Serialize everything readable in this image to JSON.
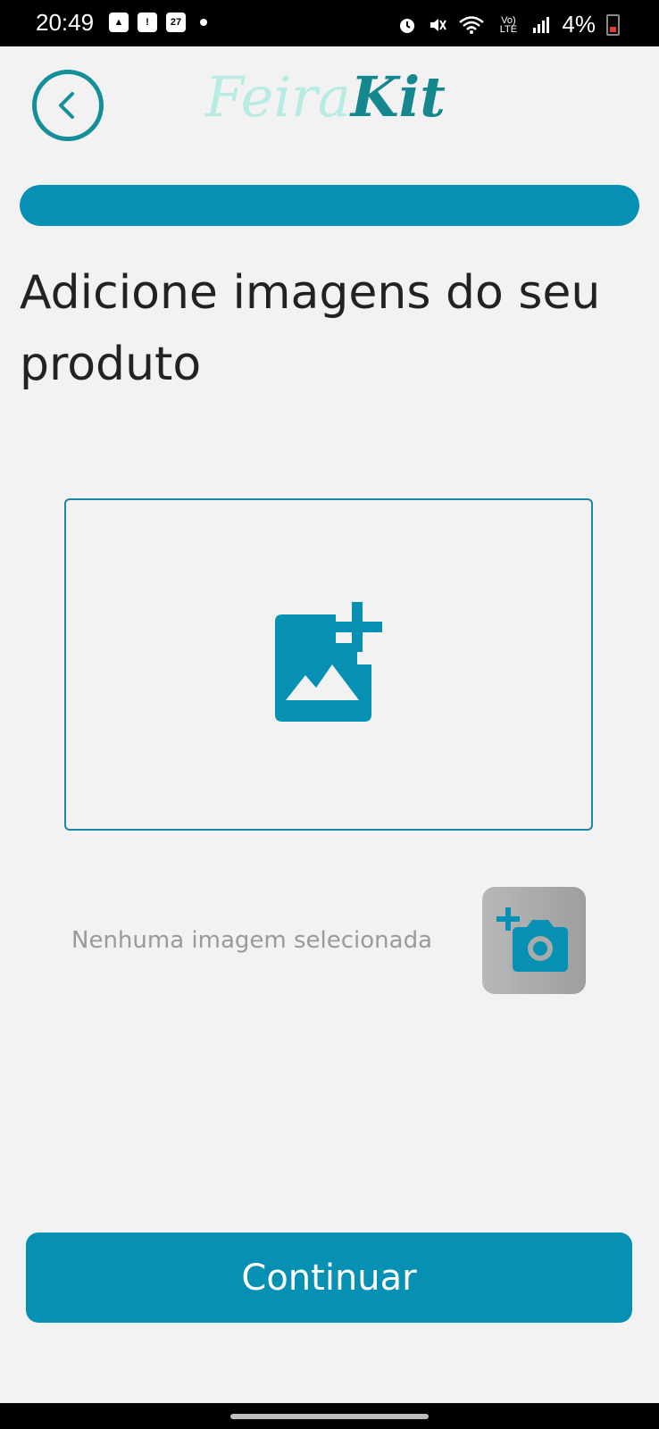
{
  "status_bar": {
    "time": "20:49",
    "calendar_day": "27",
    "network_label": "Vo) LTE",
    "battery": "4%"
  },
  "header": {
    "logo_part1": "Feira",
    "logo_part2": "Kit"
  },
  "progress": {
    "value": 1.0
  },
  "main": {
    "title": "Adicione imagens do seu produto",
    "no_image_text": "Nenhuma imagem selecionada",
    "continue_label": "Continuar"
  },
  "colors": {
    "accent": "#0690b3",
    "logo_light": "#b6ece4",
    "logo_dark": "#15878f",
    "background": "#f2f2f2"
  },
  "icons": {
    "back": "chevron-left-icon",
    "add_image": "add-photo-icon",
    "add_camera": "add-camera-icon"
  }
}
